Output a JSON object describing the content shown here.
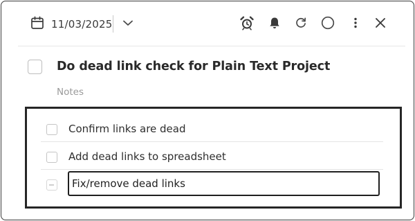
{
  "toolbar": {
    "date": "11/03/2025",
    "icons": [
      "calendar-icon",
      "chevron-down-icon",
      "alarm-clock-icon",
      "bell-icon",
      "repeat-icon",
      "circle-icon",
      "more-vertical-icon",
      "close-icon"
    ]
  },
  "task": {
    "title": "Do dead link check for Plain Text Project",
    "notes_placeholder": "Notes"
  },
  "subtasks": {
    "items": [
      {
        "label": "Confirm links are dead",
        "checked": false
      },
      {
        "label": "Add dead links to spreadsheet",
        "checked": false
      }
    ],
    "editing_value": "Fix/remove dead links"
  }
}
